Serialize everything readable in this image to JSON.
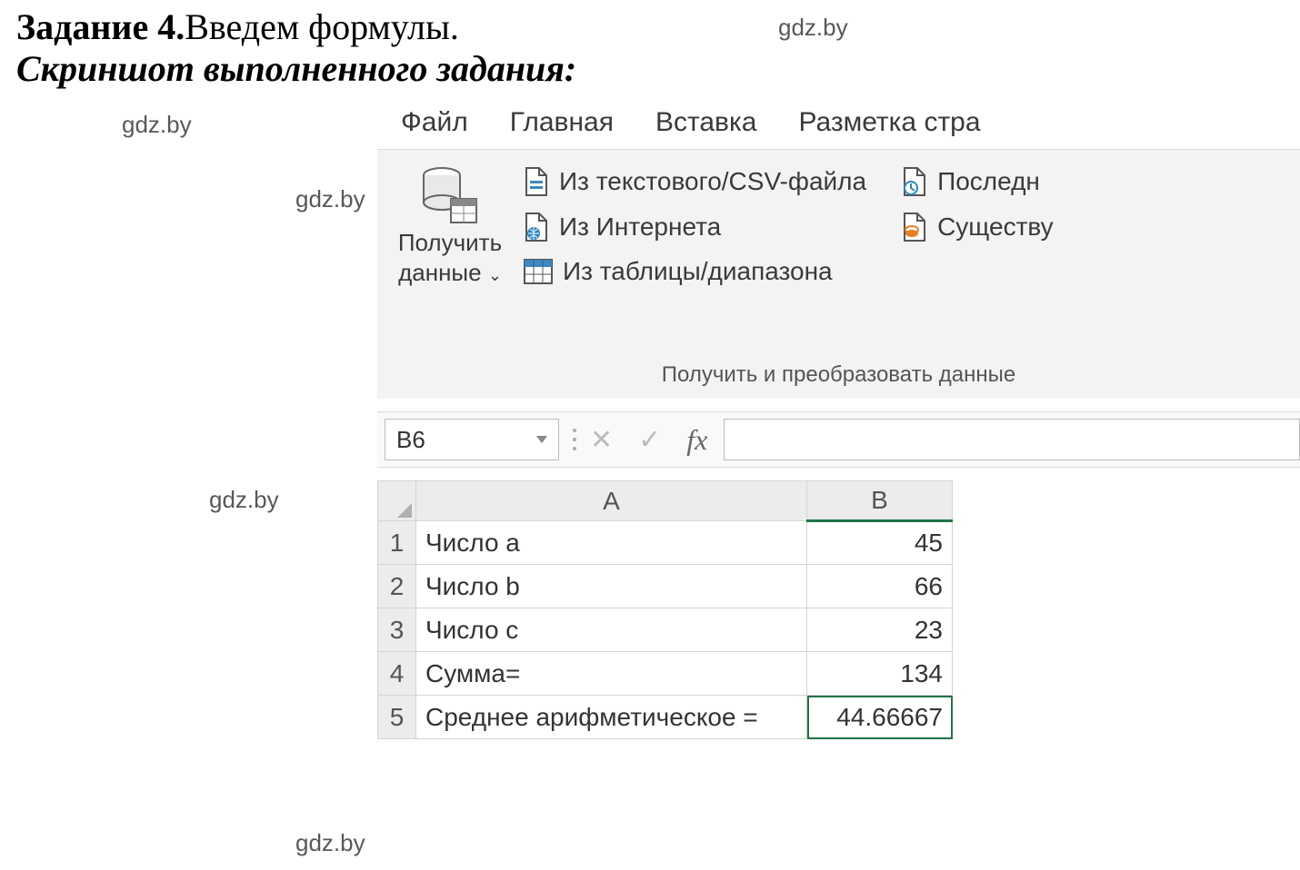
{
  "heading": {
    "strong": "Задание 4.",
    "rest": " Введем формулы."
  },
  "subheading": "Скриншот выполненного задания:",
  "watermarks": {
    "a": "gdz.by",
    "b": "gdz.by",
    "c": "gdz.by",
    "d": "gdz.by",
    "e": "gdz.by",
    "top_right": "gdz.by"
  },
  "tabs": {
    "file": "Файл",
    "home": "Главная",
    "insert": "Вставка",
    "layout": "Разметка стра"
  },
  "ribbon": {
    "get_data_1": "Получить",
    "get_data_2": "данные",
    "from_csv": "Из текстового/CSV-файла",
    "from_web": "Из Интернета",
    "from_table": "Из таблицы/диапазона",
    "recent": "Последн",
    "existing": "Существу",
    "group_label": "Получить и преобразовать данные"
  },
  "formula_bar": {
    "name_box": "B6",
    "cancel": "✕",
    "enter": "✓",
    "fx": "fx",
    "formula": ""
  },
  "columns": {
    "A": "A",
    "B": "B"
  },
  "rows": [
    {
      "n": "1",
      "a": "Число a",
      "b": "45"
    },
    {
      "n": "2",
      "a": "Число b",
      "b": "66"
    },
    {
      "n": "3",
      "a": "Число c",
      "b": "23"
    },
    {
      "n": "4",
      "a": "Сумма=",
      "b": "134"
    },
    {
      "n": "5",
      "a": "Среднее арифметическое =",
      "b": "44.66667"
    }
  ]
}
